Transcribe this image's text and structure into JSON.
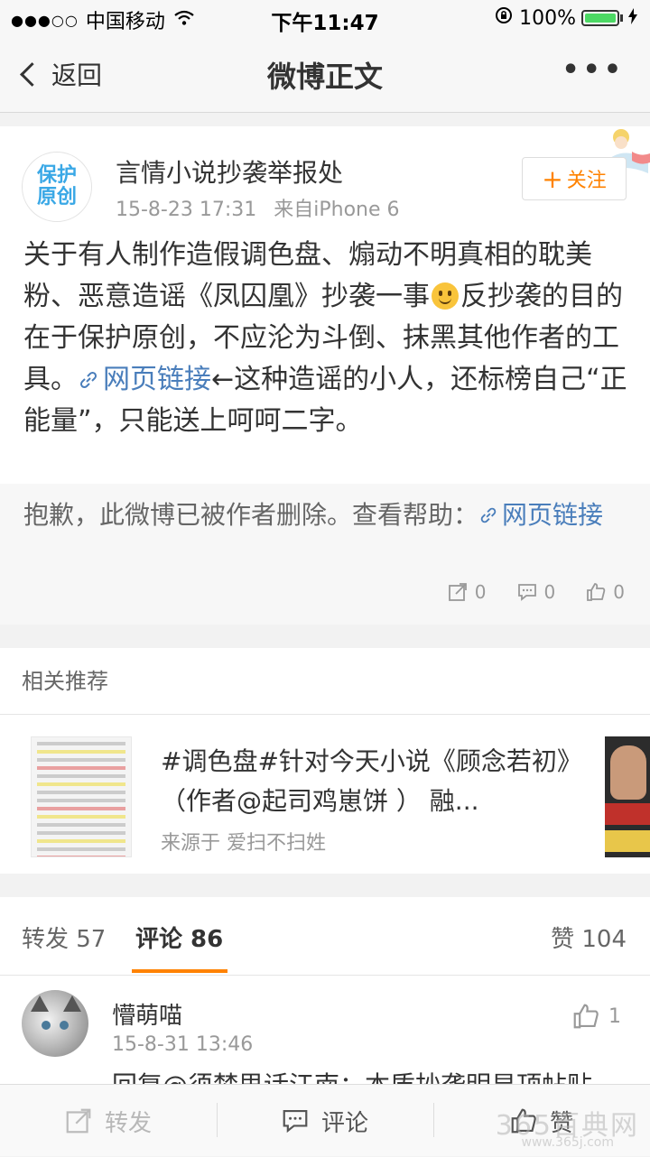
{
  "status_bar": {
    "signal": "●●●○○",
    "carrier": "中国移动",
    "time": "下午11:47",
    "battery": "100%"
  },
  "nav": {
    "back_label": "返回",
    "title": "微博正文",
    "more": "•••"
  },
  "post": {
    "avatar_text": "保护原创",
    "username": "言情小说抄袭举报处",
    "time": "15-8-23 17:31",
    "source": "来自iPhone 6",
    "follow_label": "关注",
    "text_part1": "关于有人制作造假调色盘、煽动不明真相的耽美粉、恶意造谣《凤囚凰》抄袭一事",
    "text_part2": "反抄袭的目的在于保护原创，不应沦为斗倒、抹黑其他作者的工具。",
    "link_label": "网页链接",
    "text_part3": "←这种造谣的小人，还标榜自己“正能量”，只能送上呵呵二字。",
    "deleted_notice": "抱歉，此微博已被作者删除。查看帮助：",
    "deleted_link": "网页链接",
    "repost_count": "0",
    "comment_count": "0",
    "like_count": "0"
  },
  "related": {
    "header": "相关推荐",
    "title": "#调色盘#针对今天小说《顾念若初》（作者@起司鸡崽饼 ） 融...",
    "source": "来源于 爱扫不扫姓"
  },
  "tabs": {
    "forward": "转发 57",
    "comment": "评论 86",
    "like": "赞 104"
  },
  "comment": {
    "name": "懵萌喵",
    "time": "15-8-31 13:46",
    "likes": "1",
    "text": "回复@须梦思话江南：本质抄袭明显顶帖贴"
  },
  "bottom_bar": {
    "forward": "转发",
    "comment": "评论",
    "like": "赞"
  },
  "watermark": {
    "text": "365百典网",
    "url": "www.365j.com"
  },
  "colors": {
    "accent": "#ff8200",
    "link": "#4a7ebb",
    "avatar_blue": "#3aa8e6"
  }
}
